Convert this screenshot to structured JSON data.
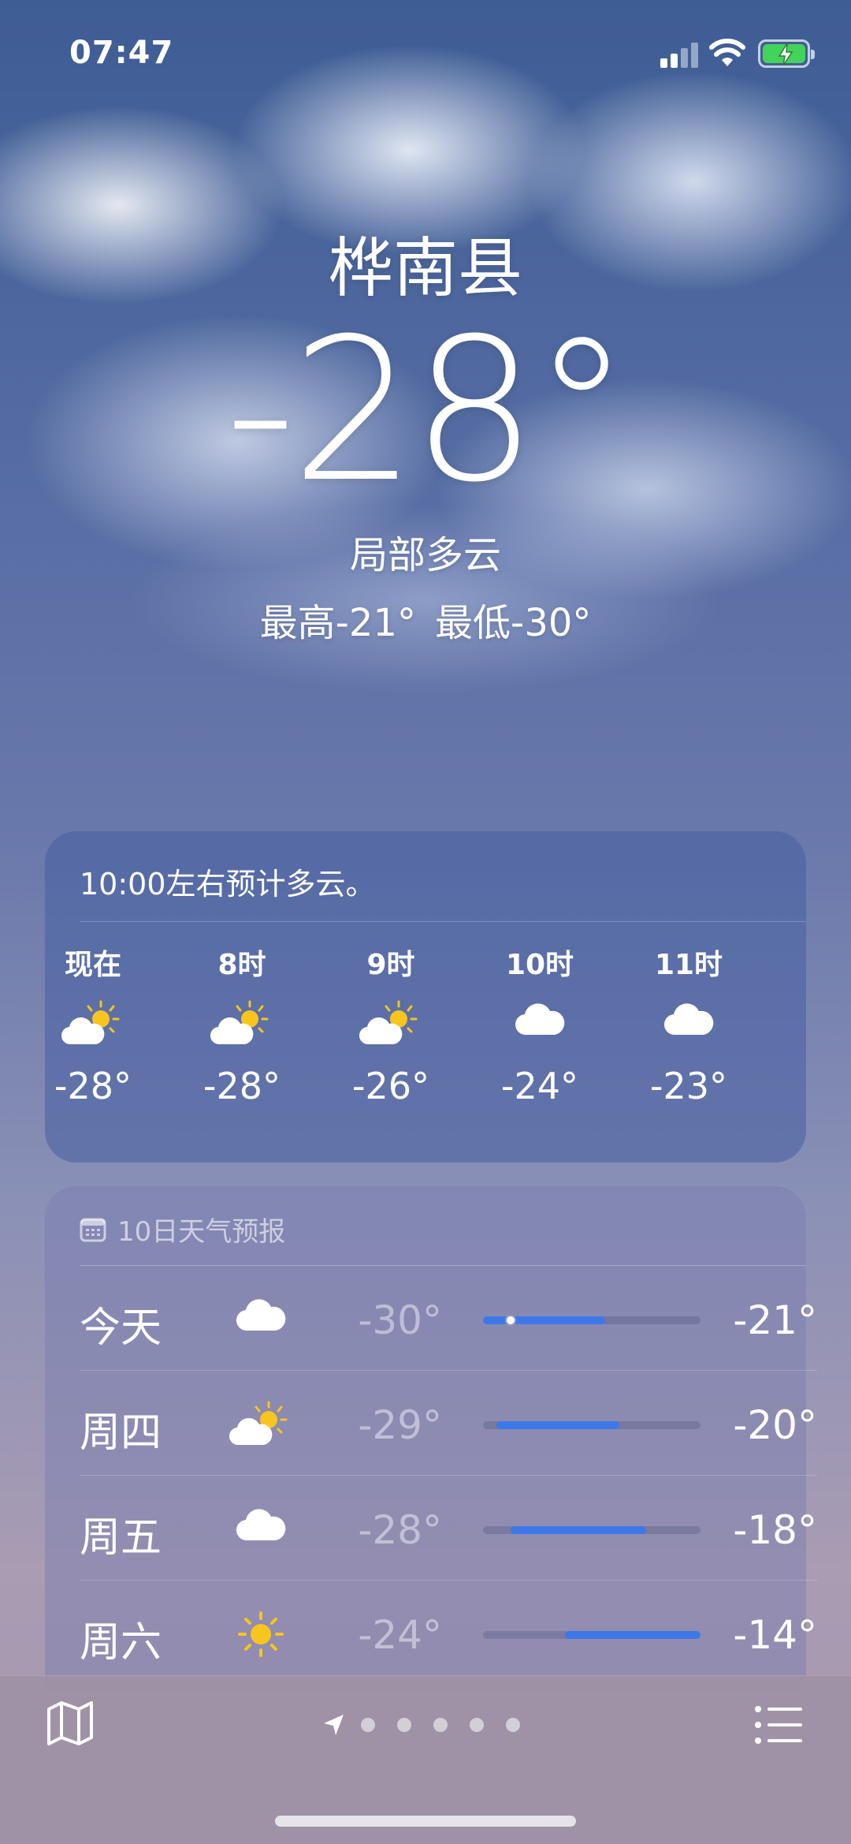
{
  "status_bar": {
    "time": "07:47",
    "signal_icon": "cellular-signal-icon",
    "wifi_icon": "wifi-icon",
    "battery_icon": "battery-charging-icon"
  },
  "location": {
    "city": "桦南县",
    "temperature": "-28°",
    "condition": "局部多云",
    "high": "最高-21°",
    "low": "最低-30°"
  },
  "hourly": {
    "summary": "10:00左右预计多云。",
    "items": [
      {
        "label": "现在",
        "icon": "partly-cloudy-icon",
        "temp": "-28°"
      },
      {
        "label": "8时",
        "icon": "partly-cloudy-icon",
        "temp": "-28°"
      },
      {
        "label": "9时",
        "icon": "partly-cloudy-icon",
        "temp": "-26°"
      },
      {
        "label": "10时",
        "icon": "cloud-icon",
        "temp": "-24°"
      },
      {
        "label": "11时",
        "icon": "cloud-icon",
        "temp": "-23°"
      }
    ]
  },
  "daily": {
    "header": "10日天气预报",
    "header_icon": "calendar-icon",
    "range": {
      "min": -30,
      "max": -14
    },
    "items": [
      {
        "day": "今天",
        "icon": "cloud-icon",
        "low": "-30°",
        "high": "-21°",
        "low_value": -30,
        "high_value": -21,
        "current_value": -28
      },
      {
        "day": "周四",
        "icon": "partly-cloudy-icon",
        "low": "-29°",
        "high": "-20°",
        "low_value": -29,
        "high_value": -20
      },
      {
        "day": "周五",
        "icon": "cloud-icon",
        "low": "-28°",
        "high": "-18°",
        "low_value": -28,
        "high_value": -18
      },
      {
        "day": "周六",
        "icon": "sun-icon",
        "low": "-24°",
        "high": "-14°",
        "low_value": -24,
        "high_value": -14
      }
    ]
  },
  "toolbar": {
    "map_icon": "map-icon",
    "location_icon": "location-arrow-icon",
    "page_count": 5,
    "list_icon": "list-icon"
  },
  "colors": {
    "temp_bar": "#3d78e8",
    "sun": "#f7c51e"
  }
}
